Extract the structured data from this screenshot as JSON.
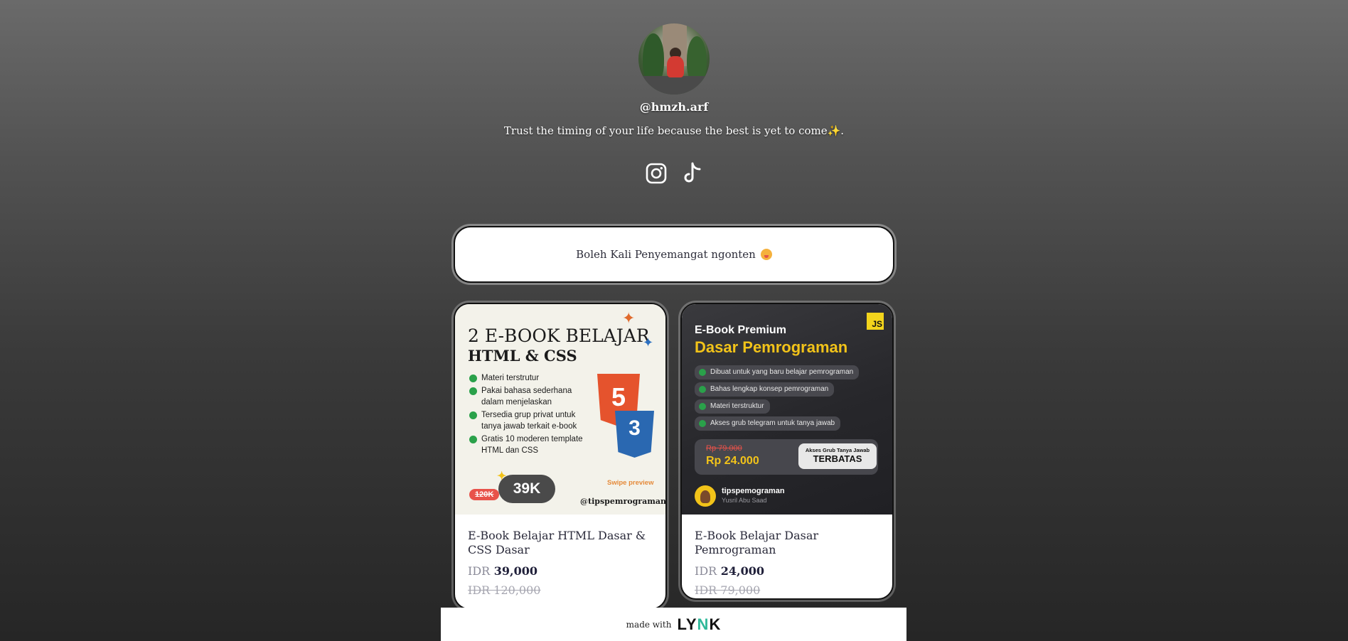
{
  "profile": {
    "handle": "@hmzh.arf",
    "bio": "Trust the timing of your life because the best is yet to come✨."
  },
  "socials": [
    {
      "name": "instagram-icon"
    },
    {
      "name": "tiktok-icon"
    }
  ],
  "link_button": {
    "label": "Boleh Kali Penyemangat ngonten",
    "emoji": "face-icon"
  },
  "products": [
    {
      "title": "E-Book Belajar HTML Dasar & CSS Dasar",
      "currency": "IDR",
      "price": "39,000",
      "old_price": "IDR 120,000",
      "thumb": {
        "heading_1": "2 E-BOOK BELAJAR",
        "heading_2": "HTML & CSS",
        "features": [
          "Materi terstrutur",
          "Pakai bahasa sederhana dalam menjelaskan",
          "Tersedia grup privat untuk tanya jawab terkait e-book",
          "Gratis 10 moderen template HTML dan CSS"
        ],
        "html_logo": "5",
        "css_logo": "3",
        "swipe": "Swipe preview",
        "badge_old": "120K",
        "badge_new": "39K",
        "brand": "@tipspemrograman"
      }
    },
    {
      "title": "E-Book Belajar Dasar Pemrograman",
      "currency": "IDR",
      "price": "24,000",
      "old_price": "IDR 79,000",
      "thumb": {
        "js": "JS",
        "heading_1": "E-Book Premium",
        "heading_2": "Dasar Pemrograman",
        "features": [
          "Dibuat untuk yang baru belajar pemrograman",
          "Bahas lengkap konsep pemrograman",
          "Materi terstruktur",
          "Akses grub telegram untuk tanya jawab"
        ],
        "price_old": "Rp 79.000",
        "price_new": "Rp 24.000",
        "cta_small": "Akses Grub Tanya Jawab",
        "cta_big": "TERBATAS",
        "username": "tipspemograman",
        "realname": "Yusril Abu Saad"
      }
    }
  ],
  "footer": {
    "made_with": "made with",
    "logo_l": "LY",
    "logo_a": "N",
    "logo_k": "K"
  }
}
